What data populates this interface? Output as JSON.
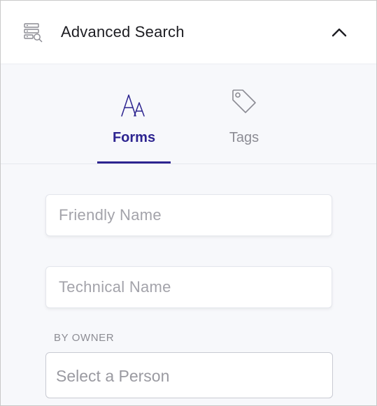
{
  "header": {
    "title": "Advanced Search",
    "icon": "advanced-search-icon",
    "collapse_icon": "chevron-up-icon"
  },
  "tabs": [
    {
      "label": "Forms",
      "icon": "font-aa-icon",
      "active": true
    },
    {
      "label": "Tags",
      "icon": "tag-icon",
      "active": false
    }
  ],
  "fields": {
    "friendly_name": {
      "placeholder": "Friendly Name",
      "value": ""
    },
    "technical_name": {
      "placeholder": "Technical Name",
      "value": ""
    }
  },
  "owner": {
    "label": "BY OWNER",
    "select_placeholder": "Select a Person"
  },
  "colors": {
    "accent": "#2d2490",
    "muted_text": "#8c8c94",
    "panel_bg": "#f7f8fb"
  }
}
